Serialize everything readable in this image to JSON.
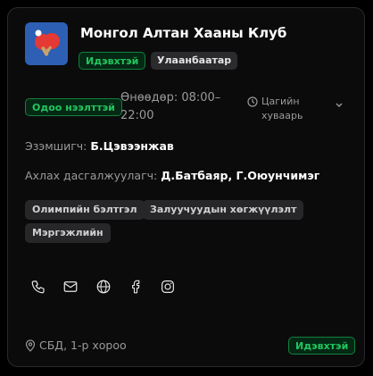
{
  "club": {
    "title": "Монгол Алтан Хааны Клуб",
    "logo_icon": "ping-pong-paddles-icon",
    "status_badge": "Идэвхтэй",
    "city_badge": "Улаанбаатар"
  },
  "hours": {
    "open_now": "Одоо нээлттэй",
    "today": "Өнөөдөр: 08:00–22:00",
    "schedule_label": "Цагийн хуваарь"
  },
  "people": {
    "owner_label": "Эзэмшигч:",
    "owner": "Б.Цэвээнжав",
    "coach_label": "Ахлах дасгалжуулагч:",
    "coaches": "Д.Батбаяр, Г.Оюунчимэг"
  },
  "tags": [
    "Олимпийн бэлтгэл",
    "Залуучуудын хөгжүүлэлт",
    "Мэргэжлийн"
  ],
  "contacts": [
    "phone-icon",
    "mail-icon",
    "globe-icon",
    "facebook-icon",
    "instagram-icon"
  ],
  "footer": {
    "address": "СБД, 1-р хороо",
    "status": "Идэвхтэй"
  },
  "colors": {
    "accent_green": "#22c55e",
    "logo_bg": "#2d5fb4"
  }
}
